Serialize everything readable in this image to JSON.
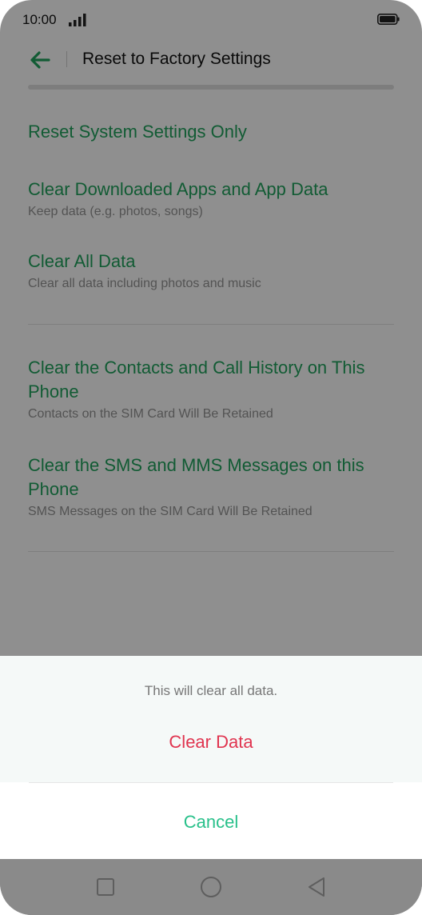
{
  "status_bar": {
    "time": "10:00"
  },
  "toolbar": {
    "title": "Reset to Factory Settings"
  },
  "options": [
    {
      "title": "Reset System Settings Only"
    },
    {
      "title": "Clear Downloaded Apps and App Data",
      "subtitle": "Keep data (e.g. photos, songs)"
    },
    {
      "title": "Clear All Data",
      "subtitle": "Clear all data including photos and music"
    },
    {
      "title": "Clear the Contacts and Call History on This Phone",
      "subtitle": "Contacts on the SIM Card Will Be Retained"
    },
    {
      "title": "Clear the SMS and MMS Messages on this Phone",
      "subtitle": "SMS Messages on the SIM Card Will Be Retained"
    }
  ],
  "dialog": {
    "message": "This will clear all data.",
    "confirm_label": "Clear Data",
    "cancel_label": "Cancel"
  },
  "colors": {
    "accent_green": "#1f9e5a",
    "danger_red": "#e0344f",
    "cancel_green": "#28c08a"
  },
  "icons": {
    "back": "arrow-left-icon",
    "signal": "signal-icon",
    "battery": "battery-icon",
    "nav_recent": "square-icon",
    "nav_home": "circle-icon",
    "nav_back": "triangle-back-icon"
  }
}
